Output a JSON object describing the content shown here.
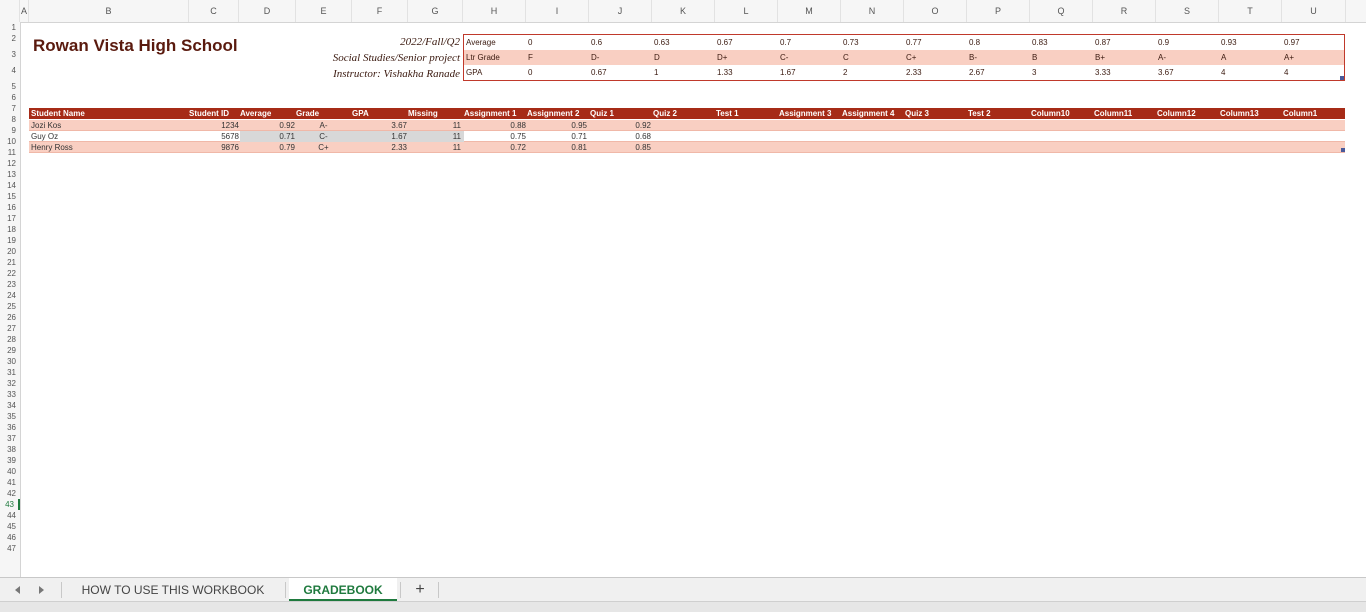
{
  "columns": [
    "A",
    "B",
    "C",
    "D",
    "E",
    "F",
    "G",
    "H",
    "I",
    "J",
    "K",
    "L",
    "M",
    "N",
    "O",
    "P",
    "Q",
    "R",
    "S",
    "T",
    "U"
  ],
  "row_numbers": [
    "1",
    "2",
    "3",
    "4",
    "5",
    "6",
    "7",
    "8",
    "9",
    "10",
    "11",
    "12",
    "13",
    "14",
    "15",
    "16",
    "17",
    "18",
    "19",
    "20",
    "21",
    "22",
    "23",
    "24",
    "25",
    "26",
    "27",
    "28",
    "29",
    "30",
    "31",
    "32",
    "33",
    "34",
    "35",
    "36",
    "37",
    "38",
    "39",
    "40",
    "41",
    "42",
    "43",
    "44",
    "45",
    "46",
    "47"
  ],
  "active_row": "43",
  "school_title": "Rowan Vista High School",
  "info": {
    "term": "2022/Fall/Q2",
    "course": "Social Studies/Senior project",
    "instructor": "Instructor: Vishakha Ranade"
  },
  "grade_scale": {
    "rows": [
      {
        "label": "Average",
        "values": [
          "0",
          "0.6",
          "0.63",
          "0.67",
          "0.7",
          "0.73",
          "0.77",
          "0.8",
          "0.83",
          "0.87",
          "0.9",
          "0.93",
          "0.97"
        ]
      },
      {
        "label": "Ltr Grade",
        "values": [
          "F",
          "D-",
          "D",
          "D+",
          "C-",
          "C",
          "C+",
          "B-",
          "B",
          "B+",
          "A-",
          "A",
          "A+"
        ]
      },
      {
        "label": "GPA",
        "values": [
          "0",
          "0.67",
          "1",
          "1.33",
          "1.67",
          "2",
          "2.33",
          "2.67",
          "3",
          "3.33",
          "3.67",
          "4",
          "4"
        ]
      }
    ]
  },
  "table": {
    "headers": [
      "Student Name",
      "Student ID",
      "Average",
      "Grade",
      "GPA",
      "Missing",
      "Assignment 1",
      "Assignment 2",
      "Quiz 1",
      "Quiz 2",
      "Test 1",
      "Assignment 3",
      "Assignment 4",
      "Quiz 3",
      "Test 2",
      "Column10",
      "Column11",
      "Column12",
      "Column13",
      "Column1"
    ],
    "rows": [
      {
        "name": "Jozi Kos",
        "id": "1234",
        "average": "0.92",
        "grade": "A-",
        "gpa": "3.67",
        "missing": "11",
        "a1": "0.88",
        "a2": "0.95",
        "q1": "0.92"
      },
      {
        "name": "Guy Oz",
        "id": "5678",
        "average": "0.71",
        "grade": "C-",
        "gpa": "1.67",
        "missing": "11",
        "a1": "0.75",
        "a2": "0.71",
        "q1": "0.68"
      },
      {
        "name": "Henry Ross",
        "id": "9876",
        "average": "0.79",
        "grade": "C+",
        "gpa": "2.33",
        "missing": "11",
        "a1": "0.72",
        "a2": "0.81",
        "q1": "0.85"
      }
    ]
  },
  "tabs": [
    {
      "label": "HOW TO USE THIS WORKBOOK",
      "active": false
    },
    {
      "label": "GRADEBOOK",
      "active": true
    }
  ],
  "add_sheet_label": "+",
  "colors": {
    "header_bg": "#a62b17",
    "row_even": "#f9cfc2",
    "row_odd": "#ffffff",
    "title": "#5a1a0e",
    "active_tab": "#1f7a3e"
  }
}
